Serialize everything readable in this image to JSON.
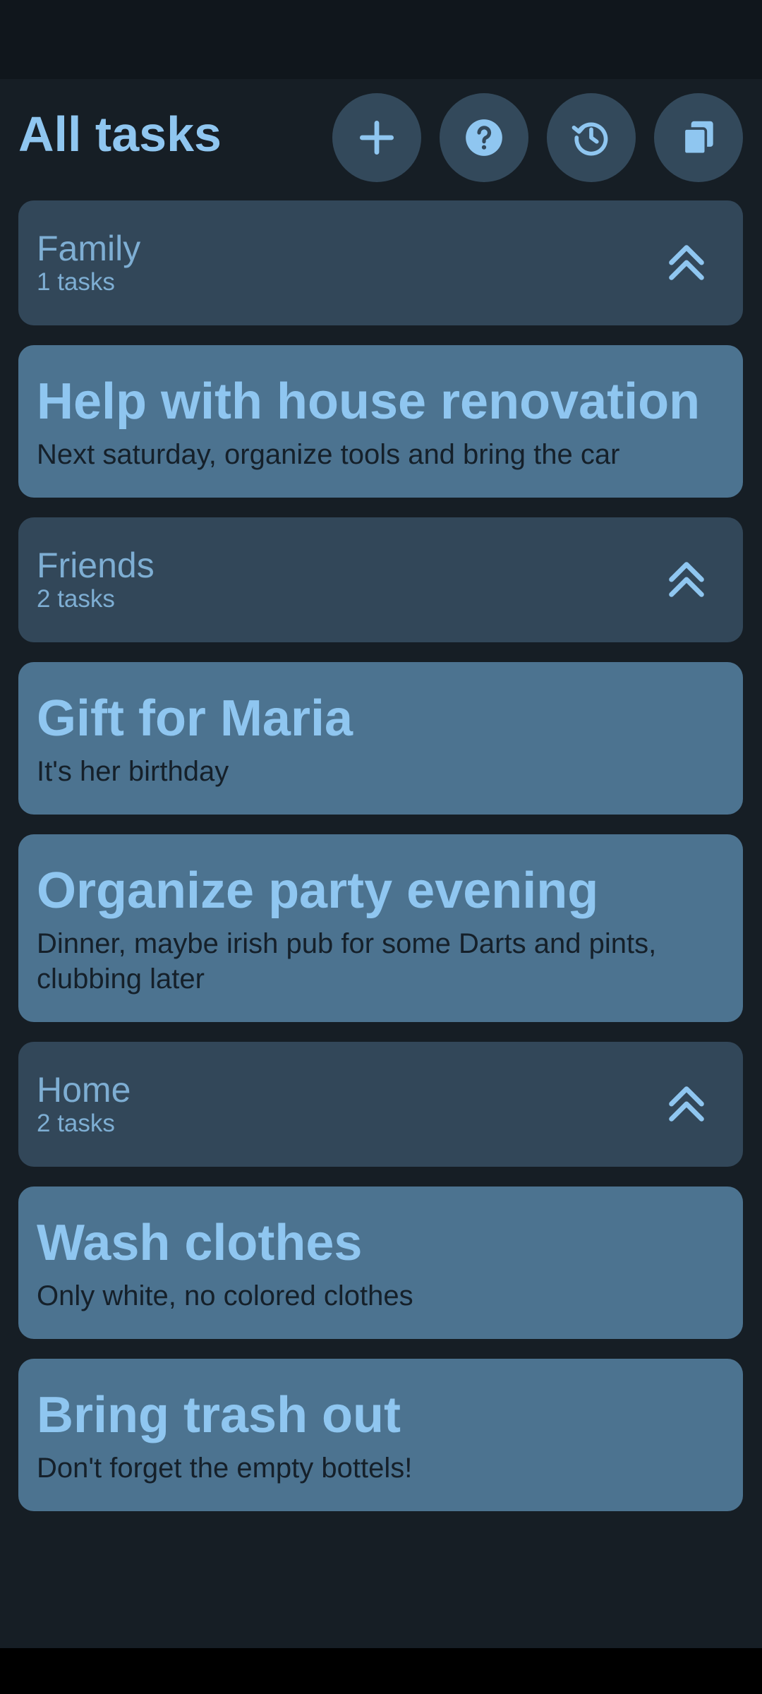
{
  "header": {
    "title": "All tasks",
    "buttons": [
      {
        "icon": "plus-icon"
      },
      {
        "icon": "help-icon"
      },
      {
        "icon": "history-icon"
      },
      {
        "icon": "copy-icon"
      }
    ]
  },
  "groups": [
    {
      "name": "Family",
      "count": "1 tasks",
      "tasks": [
        {
          "title": "Help with house renovation",
          "description": "Next saturday, organize tools and bring the car"
        }
      ]
    },
    {
      "name": "Friends",
      "count": "2 tasks",
      "tasks": [
        {
          "title": "Gift for Maria",
          "description": "It's her birthday"
        },
        {
          "title": "Organize party evening",
          "description": "Dinner, maybe irish pub for some Darts and pints, clubbing later"
        }
      ]
    },
    {
      "name": "Home",
      "count": "2 tasks",
      "tasks": [
        {
          "title": "Wash clothes",
          "description": "Only white, no colored clothes"
        },
        {
          "title": "Bring trash out",
          "description": "Don't forget the empty bottels!"
        }
      ]
    }
  ],
  "colors": {
    "background": "#161e25",
    "group_card": "#324759",
    "task_card": "#4c7390",
    "accent": "#8fc6f0",
    "button_bg": "#33495b"
  }
}
